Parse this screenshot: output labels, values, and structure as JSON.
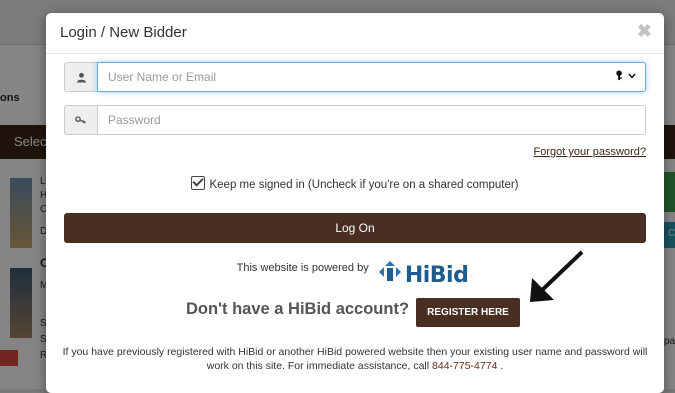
{
  "background": {
    "tabs_fragment": "ons",
    "select_fragment": "Selec",
    "list_letters": [
      "L",
      "H",
      "C",
      "D",
      "C",
      "M",
      "S",
      "S",
      "R"
    ],
    "right_fragment": "C",
    "right_text_fragment": "pa"
  },
  "modal": {
    "title": "Login / New Bidder",
    "close_glyph": "✖",
    "username": {
      "placeholder": "User Name or Email",
      "value": ""
    },
    "password": {
      "placeholder": "Password",
      "value": ""
    },
    "forgot_link": "Forgot your password?",
    "keep_signed_in": "Keep me signed in (Uncheck if you're on a shared computer)",
    "keep_checked": true,
    "logon_button": "Log On",
    "powered_by": "This website is powered by",
    "brand": "HiBid",
    "no_account": "Don't have a HiBid account?",
    "register_button": "REGISTER HERE",
    "info_text_part1": "If you have previously registered with HiBid or another HiBid powered website then your existing user name and password will work on this site. For immediate assistance, call",
    "info_phone": "844-775-4774",
    "info_text_end": "."
  },
  "colors": {
    "brand_brown": "#4a2e21",
    "hibid_blue": "#1d5c8f",
    "focus_blue": "#66afe9"
  }
}
